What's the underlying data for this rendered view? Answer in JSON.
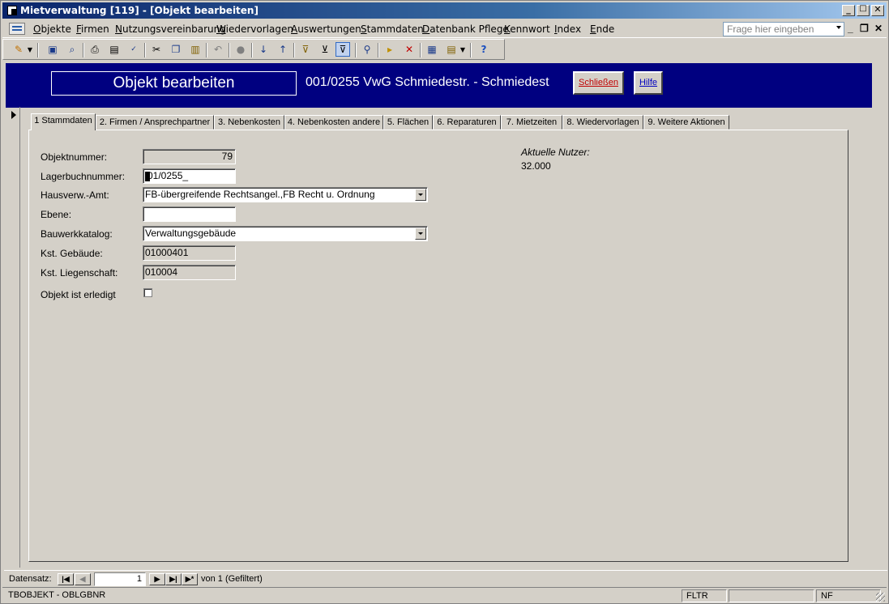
{
  "window": {
    "title": "Mietverwaltung [119] - [Objekt bearbeiten]",
    "buttons": {
      "minimize": "_",
      "maximize": "□",
      "close": "✕"
    }
  },
  "menubar": {
    "items": [
      "Objekte",
      "Firmen",
      "Nutzungsvereinbarung",
      "Wiedervorlagen",
      "Auswertungen",
      "Stammdaten",
      "Datenbank Pflege",
      "Kennwort",
      "Index",
      "Ende"
    ],
    "ask_placeholder": "Frage hier eingeben",
    "mdi_min": "_",
    "mdi_restore": "❐",
    "mdi_close": "✕"
  },
  "toolbar": {
    "icons": [
      "design-view-icon",
      "save-icon",
      "print-preview-icon",
      "print-icon",
      "search-file-icon",
      "spell-check-icon",
      "cut-icon",
      "copy-icon",
      "paste-icon",
      "undo-icon",
      "hyperlink-icon",
      "sort-ascending-icon",
      "sort-descending-icon",
      "filter-by-selection-icon",
      "filter-by-form-icon",
      "apply-filter-icon",
      "find-icon",
      "new-record-icon",
      "delete-record-icon",
      "database-window-icon",
      "new-object-icon",
      "help-icon"
    ]
  },
  "header": {
    "title": "Objekt bearbeiten",
    "subtitle": "001/0255 VwG Schmiedestr. - Schmiedest",
    "close_label": "Schließen",
    "help_label": "Hilfe"
  },
  "tabs": [
    {
      "label": "1 Stammdaten",
      "active": true
    },
    {
      "label": "2. Firmen / Ansprechpartner",
      "active": false
    },
    {
      "label": "3. Nebenkosten",
      "active": false
    },
    {
      "label": "4. Nebenkosten andere",
      "active": false
    },
    {
      "label": "5. Flächen",
      "active": false
    },
    {
      "label": "6. Reparaturen",
      "active": false
    },
    {
      "label": "7. Mietzeiten",
      "active": false
    },
    {
      "label": "8. Wiedervorlagen",
      "active": false
    },
    {
      "label": "9. Weitere Aktionen",
      "active": false
    }
  ],
  "form": {
    "objektnummer": {
      "label": "Objektnummer:",
      "value": "79"
    },
    "lagerbuchnummer": {
      "label": "Lagerbuchnummer:",
      "value": "01/0255_"
    },
    "hausverw": {
      "label": "Hausverw.-Amt:",
      "value": "FB-übergreifende Rechtsangel.,FB Recht u. Ordnung"
    },
    "ebene": {
      "label": "Ebene:",
      "value": ""
    },
    "bauwerkkatalog": {
      "label": "Bauwerkkatalog:",
      "value": "Verwaltungsgebäude"
    },
    "kst_gebaeude": {
      "label": "Kst. Gebäude:",
      "value": "01000401"
    },
    "kst_liegenschaft": {
      "label": "Kst. Liegenschaft:",
      "value": "010004"
    },
    "erledigt": {
      "label": "Objekt ist erledigt",
      "checked": false
    },
    "nutzer": {
      "label": "Aktuelle Nutzer:",
      "value": "32.000"
    }
  },
  "navigation": {
    "label": "Datensatz:",
    "current": "1",
    "of_text": "von  1 (Gefiltert)"
  },
  "status": {
    "field": "TBOBJEKT - OBLGBNR",
    "fltr": "FLTR",
    "nf": "NF"
  }
}
